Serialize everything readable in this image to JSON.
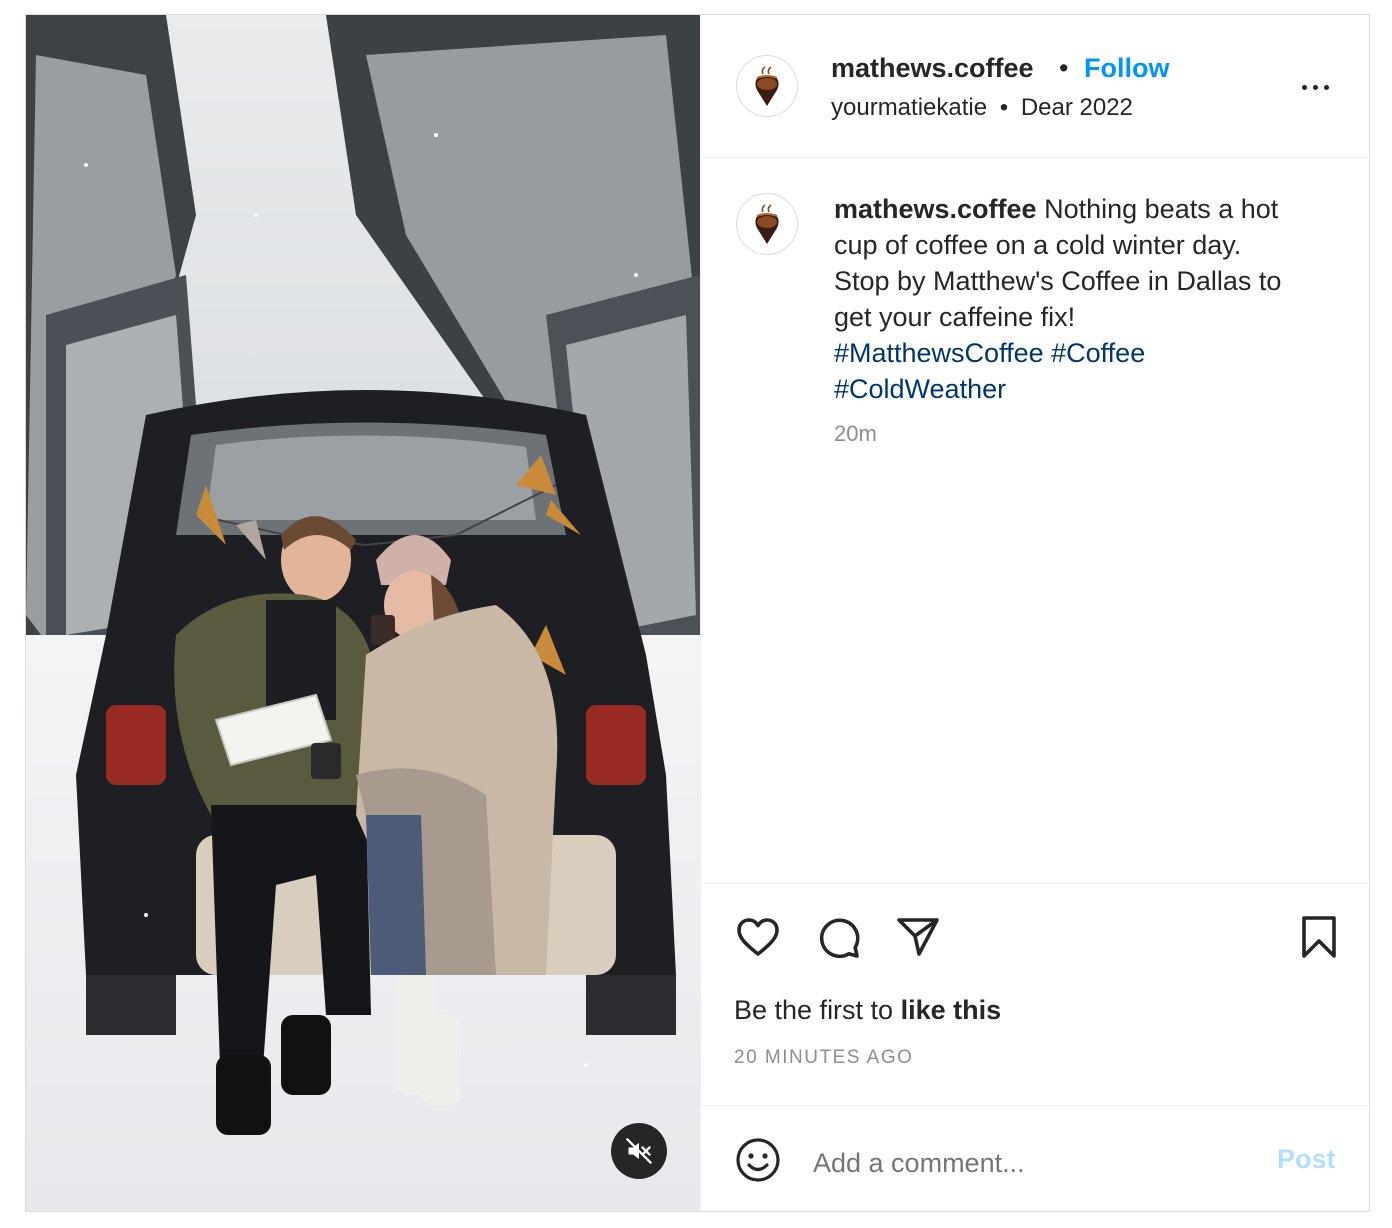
{
  "post": {
    "account": "mathews.coffee",
    "separator_dot": "•",
    "follow_label": "Follow",
    "subtitle_user": "yourmatiekatie",
    "subtitle_location": "Dear 2022",
    "caption_text": "Nothing beats a hot cup of coffee on a cold winter day. Stop by Matthew's Coffee in Dallas to get your caffeine fix!",
    "hashtags": [
      "#MatthewsCoffee",
      "#Coffee",
      "#ColdWeather"
    ],
    "caption_time": "20m",
    "likes_prefix": "Be the first to",
    "likes_link": "like this",
    "posted_ago": "20 MINUTES AGO",
    "comment_placeholder": "Add a comment...",
    "post_button": "Post"
  },
  "icons": {
    "more": "more-options-icon",
    "like": "heart-icon",
    "comment": "comment-icon",
    "share": "paper-plane-icon",
    "save": "bookmark-icon",
    "emoji": "emoji-icon",
    "mute": "muted-speaker-icon",
    "avatar": "coffee-pin-logo"
  },
  "colors": {
    "follow": "#0095f6",
    "hashtag": "#00376b",
    "post_disabled": "#b2dffc",
    "muted_text": "#8e8e8e"
  }
}
